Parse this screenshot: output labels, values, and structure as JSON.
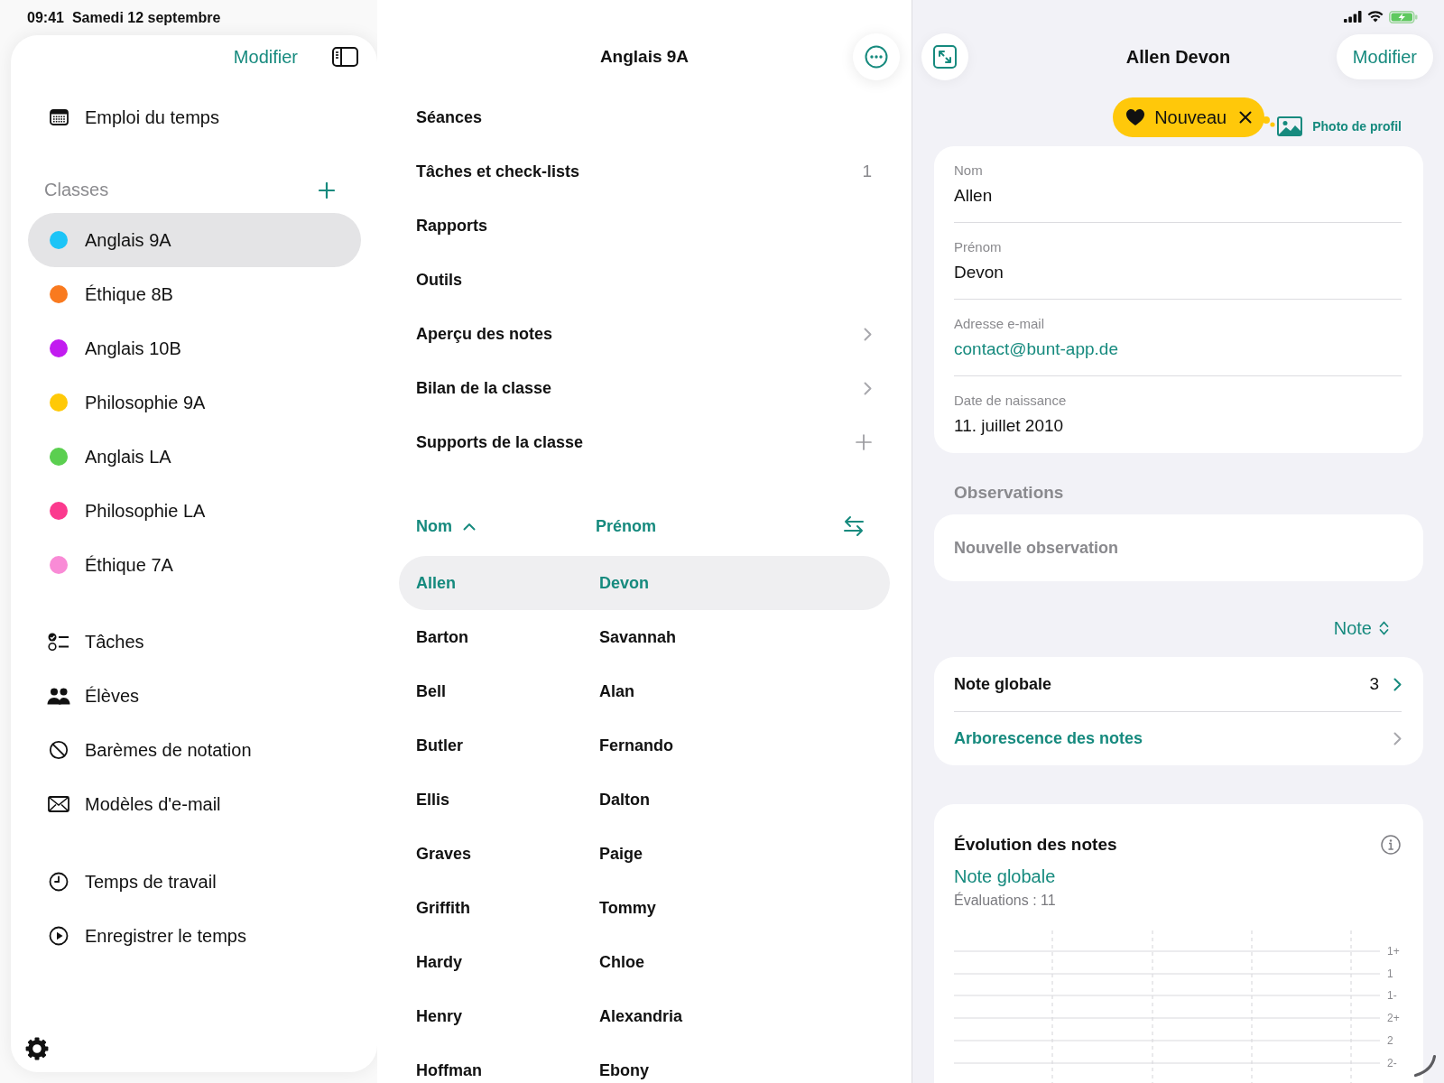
{
  "status_bar": {
    "time": "09:41",
    "date": "Samedi 12 septembre"
  },
  "sidebar": {
    "edit_button": "Modifier",
    "schedule": "Emploi du temps",
    "classes_header": "Classes",
    "classes": [
      {
        "name": "Anglais 9A",
        "color": "#1cc4f7",
        "selected": true
      },
      {
        "name": "Éthique 8B",
        "color": "#f97a1f",
        "selected": false
      },
      {
        "name": "Anglais 10B",
        "color": "#c21cf0",
        "selected": false
      },
      {
        "name": "Philosophie 9A",
        "color": "#ffc907",
        "selected": false
      },
      {
        "name": "Anglais LA",
        "color": "#5bcf50",
        "selected": false
      },
      {
        "name": "Philosophie LA",
        "color": "#fb3a8e",
        "selected": false
      },
      {
        "name": "Éthique 7A",
        "color": "#f98bd6",
        "selected": false
      }
    ],
    "tools": [
      "Tâches",
      "Élèves",
      "Barèmes de notation",
      "Modèles d'e-mail"
    ],
    "time_tracking": [
      "Temps de travail",
      "Enregistrer le temps"
    ]
  },
  "class_panel": {
    "title": "Anglais 9A",
    "menu": [
      {
        "label": "Séances",
        "kind": "plain"
      },
      {
        "label": "Tâches et check-lists",
        "kind": "count",
        "count": "1"
      },
      {
        "label": "Rapports",
        "kind": "plain"
      },
      {
        "label": "Outils",
        "kind": "plain"
      },
      {
        "label": "Aperçu des notes",
        "kind": "chevron"
      },
      {
        "label": "Bilan de la classe",
        "kind": "chevron"
      },
      {
        "label": "Supports de la classe",
        "kind": "add"
      }
    ],
    "table": {
      "columns": [
        {
          "label": "Nom",
          "sorted": true
        },
        {
          "label": "Prénom",
          "sorted": false
        }
      ],
      "rows": [
        {
          "last_name": "Allen",
          "first_name": "Devon",
          "selected": true
        },
        {
          "last_name": "Barton",
          "first_name": "Savannah",
          "selected": false
        },
        {
          "last_name": "Bell",
          "first_name": "Alan",
          "selected": false
        },
        {
          "last_name": "Butler",
          "first_name": "Fernando",
          "selected": false
        },
        {
          "last_name": "Ellis",
          "first_name": "Dalton",
          "selected": false
        },
        {
          "last_name": "Graves",
          "first_name": "Paige",
          "selected": false
        },
        {
          "last_name": "Griffith",
          "first_name": "Tommy",
          "selected": false
        },
        {
          "last_name": "Hardy",
          "first_name": "Chloe",
          "selected": false
        },
        {
          "last_name": "Henry",
          "first_name": "Alexandria",
          "selected": false
        },
        {
          "last_name": "Hoffman",
          "first_name": "Ebony",
          "selected": false
        }
      ]
    }
  },
  "student_panel": {
    "title": "Allen Devon",
    "edit_button": "Modifier",
    "tag": {
      "label": "Nouveau"
    },
    "photo_button": "Photo de profil",
    "fields": [
      {
        "label": "Nom",
        "value": "Allen",
        "kind": "text"
      },
      {
        "label": "Prénom",
        "value": "Devon",
        "kind": "text"
      },
      {
        "label": "Adresse e-mail",
        "value": "contact@bunt-app.de",
        "kind": "link"
      },
      {
        "label": "Date de naissance",
        "value": "11. juillet 2010",
        "kind": "text"
      }
    ],
    "observations": {
      "header": "Observations",
      "placeholder": "Nouvelle observation"
    },
    "grade_picker": "Note",
    "grades": [
      {
        "label": "Note globale",
        "kind": "value",
        "value": "3"
      },
      {
        "label": "Arborescence des notes",
        "kind": "link"
      }
    ],
    "chart": {
      "title": "Évolution des notes",
      "series": "Note globale",
      "count": "Évaluations : 11",
      "y_labels": [
        "1+",
        "1",
        "1-",
        "2+",
        "2",
        "2-"
      ]
    }
  }
}
